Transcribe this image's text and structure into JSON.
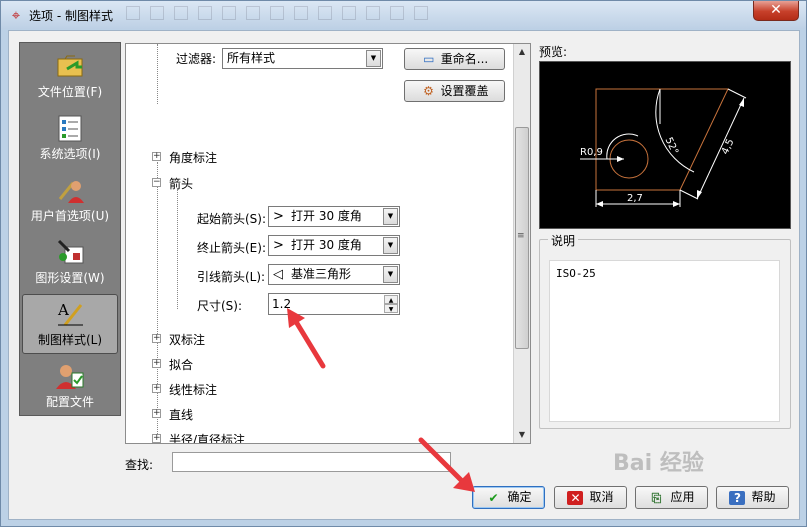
{
  "window": {
    "title": "选项 - 制图样式",
    "close_label": "✕"
  },
  "nav": {
    "items": [
      {
        "label": "文件位置(F)",
        "icon": "folder-arrow-icon"
      },
      {
        "label": "系统选项(I)",
        "icon": "checklist-icon"
      },
      {
        "label": "用户首选项(U)",
        "icon": "user-tools-icon"
      },
      {
        "label": "图形设置(W)",
        "icon": "graphics-settings-icon"
      },
      {
        "label": "制图样式(L)",
        "icon": "drafting-style-icon",
        "selected": true
      },
      {
        "label": "配置文件",
        "icon": "profile-icon"
      }
    ]
  },
  "tree": {
    "filter_label": "过滤器:",
    "filter_value": "所有样式",
    "rename_button": "重命名...",
    "override_button": "设置覆盖",
    "nodes": {
      "angle": "角度标注",
      "arrow": "箭头",
      "dual": "双标注",
      "fit": "拟合",
      "linear": "线性标注",
      "line": "直线",
      "radius": "半径/直径标注"
    },
    "arrow_props": {
      "start_label": "起始箭头(S):",
      "start_value": "打开 30 度角",
      "end_label": "终止箭头(E):",
      "end_value": "打开 30 度角",
      "leader_label": "引线箭头(L):",
      "leader_value": "基准三角形",
      "size_label": "尺寸(S):",
      "size_value": "1.2"
    }
  },
  "find": {
    "label": "查找:",
    "value": ""
  },
  "preview": {
    "label": "预览:",
    "dims": {
      "radius": "R0,9",
      "angle": "52°",
      "aligned": "4,5",
      "linear": "2,7"
    }
  },
  "description": {
    "label": "说明",
    "text": "ISO-25"
  },
  "buttons": {
    "ok": "确定",
    "cancel": "取消",
    "apply": "应用",
    "help": "帮助"
  },
  "watermark": "Bai 经验",
  "colors": {
    "nav_bg": "#7f7f7f",
    "preview_bg": "#000000",
    "annotation_red": "#e8383d",
    "geometry_orange": "#c8733c"
  }
}
